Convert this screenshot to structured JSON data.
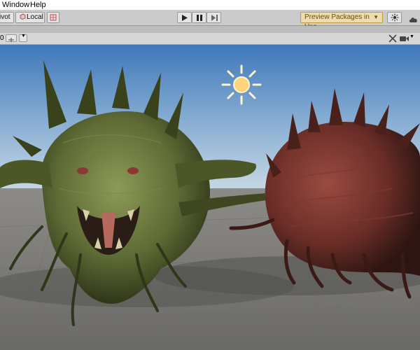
{
  "menu": {
    "window_label": "Window",
    "help_label": "Help"
  },
  "toolbar": {
    "pivot_label": "ivot",
    "local_label": "Local",
    "play_icon": "play-icon",
    "pause_icon": "pause-icon",
    "step_icon": "step-icon",
    "preview_packages_label": "Preview Packages in Use",
    "preview_accent": "#c39a3c"
  },
  "scene_bar": {
    "left_value": "0"
  },
  "scene": {
    "sky_top": "#3f78ba",
    "sky_bottom": "#cfdde6",
    "ground": "#7c7b78",
    "light_icon": "sun-icon",
    "creature_green": "#5e6b35",
    "creature_red": "#6a2d27"
  }
}
